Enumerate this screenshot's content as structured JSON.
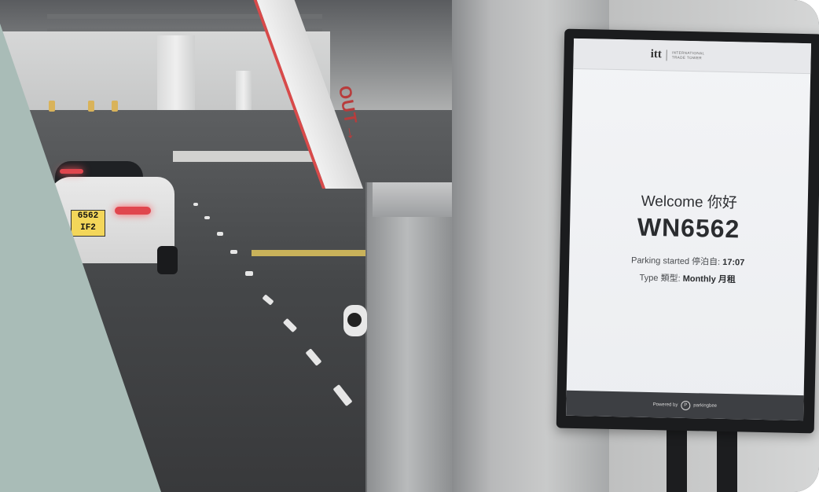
{
  "scene": {
    "out_sign": "OUT→",
    "car_plate_line1": "6562",
    "car_plate_line2": "IF2"
  },
  "kiosk": {
    "brand_mark": "itt",
    "brand_name": "INTERNATIONAL TRADE TOWER",
    "welcome": "Welcome 你好",
    "plate": "WN6562",
    "parking_label": "Parking started 停泊自: ",
    "parking_time": "17:07",
    "type_label": "Type 類型: ",
    "type_value": "Monthly 月租",
    "footer_powered": "Powered by",
    "footer_logo": "P",
    "footer_brand": "parkingbee"
  },
  "colors": {
    "teal_overlay": "#a9bcb7",
    "brake_light": "#e0464e",
    "barrier_stripe": "#d84a4a"
  }
}
